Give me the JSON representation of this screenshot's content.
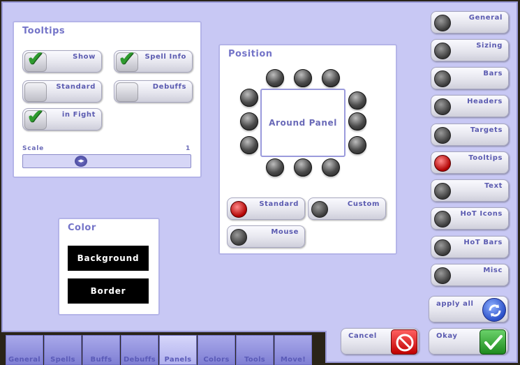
{
  "tooltips": {
    "title": "Tooltips",
    "checkboxes": [
      {
        "label": "Show",
        "checked": true
      },
      {
        "label": "Spell Info",
        "checked": true
      },
      {
        "label": "Standard",
        "checked": false
      },
      {
        "label": "Debuffs",
        "checked": false
      },
      {
        "label": "in Fight",
        "checked": true
      }
    ],
    "scale_label": "Scale",
    "scale_value": "1"
  },
  "position": {
    "title": "Position",
    "center_label": "Around Panel",
    "mode_options": [
      {
        "label": "Standard",
        "selected": true
      },
      {
        "label": "Custom",
        "selected": false
      },
      {
        "label": "Mouse",
        "selected": false
      }
    ]
  },
  "color": {
    "title": "Color",
    "background_label": "Background",
    "border_label": "Border"
  },
  "sidebar": {
    "items": [
      {
        "label": "General",
        "selected": false
      },
      {
        "label": "Sizing",
        "selected": false
      },
      {
        "label": "Bars",
        "selected": false
      },
      {
        "label": "Headers",
        "selected": false
      },
      {
        "label": "Targets",
        "selected": false
      },
      {
        "label": "Tooltips",
        "selected": true
      },
      {
        "label": "Text",
        "selected": false
      },
      {
        "label": "HoT Icons",
        "selected": false
      },
      {
        "label": "HoT Bars",
        "selected": false
      },
      {
        "label": "Misc",
        "selected": false
      }
    ]
  },
  "actions": {
    "apply_all": "apply all",
    "cancel": "Cancel",
    "okay": "Okay"
  },
  "tabs": [
    {
      "label": "General",
      "active": false
    },
    {
      "label": "Spells",
      "active": false
    },
    {
      "label": "Buffs",
      "active": false
    },
    {
      "label": "Debuffs",
      "active": false
    },
    {
      "label": "Panels",
      "active": true
    },
    {
      "label": "Colors",
      "active": false
    },
    {
      "label": "Tools",
      "active": false
    },
    {
      "label": "Move!",
      "active": false
    }
  ],
  "colors": {
    "window_bg": "#c8c8f4",
    "accent_text": "#5a5ab0",
    "selected_radio": "#b00000",
    "check": "#2e9a2e"
  },
  "icons": {
    "check": "check-icon",
    "cancel": "no-entry-icon",
    "okay": "checkmark-icon",
    "apply": "refresh-arrows-icon"
  }
}
